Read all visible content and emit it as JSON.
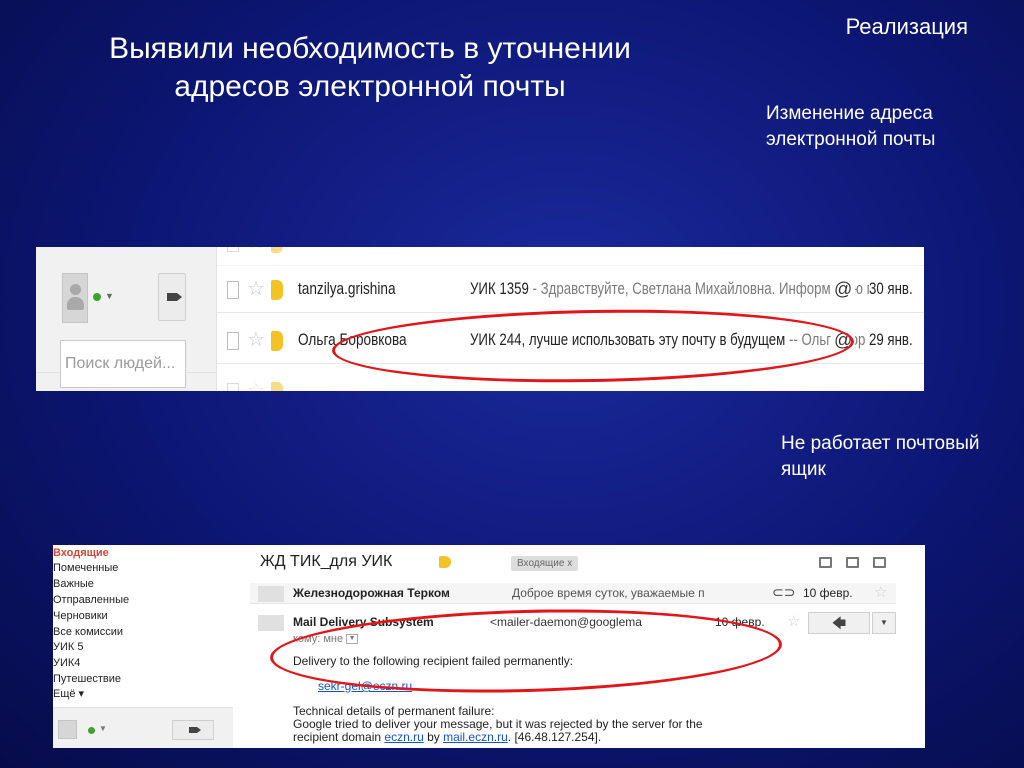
{
  "slide": {
    "title": "Выявили необходимость в уточнении адресов электронной почты",
    "section": "Реализация",
    "note_email_change": "Изменение адреса электронной почты",
    "note_mailbox_broken": "Не работает почтовый ящик"
  },
  "screenshot1": {
    "people_search_placeholder": "Поиск людей...",
    "rows": [
      {
        "sender": "tanzilya.grishina",
        "subject": "УИК 1359",
        "snippet": " - Здравствуйте, Светлана Михайловна. Информацию пр",
        "date": "30 янв."
      },
      {
        "sender": "Ольга Боровкова",
        "subject": "УИК 244, лучше использовать эту почту в будущем",
        "snippet": " -- Ольга Бор",
        "date": "29 янв."
      }
    ]
  },
  "screenshot2": {
    "nav": [
      "Входящие",
      "Помеченные",
      "Важные",
      "Отправленные",
      "Черновики",
      "Все комиссии",
      "УИК 5",
      "УИК4",
      "Путешествие",
      "Ещё ▾"
    ],
    "thread_subject": "ЖД ТИК_для УИК",
    "inbox_chip": "Входящие  x",
    "messages": [
      {
        "from": "Железнодорожная Терком",
        "snippet": "Доброе время суток, уважаемые п",
        "date": "10 февр."
      },
      {
        "from": "Mail Delivery Subsystem",
        "email": "<mailer-daemon@googlema",
        "date": "10 февр."
      }
    ],
    "to_line": "кому: мне",
    "body": {
      "line1": "Delivery to the following recipient failed permanently:",
      "recipient": "sekr-gel@eczn.ru",
      "line3": "Technical details of permanent failure:",
      "line4": "Google tried to deliver your message, but it was rejected by the server for the",
      "line5_prefix": "recipient domain ",
      "line5_domain": "eczn.ru",
      "line5_by": " by ",
      "line5_server": "mail.eczn.ru",
      "line5_suffix": ". [46.48.127.254]."
    }
  },
  "colors": {
    "highlight": "#e0161b",
    "label_tag": "#f3c325",
    "active_label": "#d14836"
  }
}
